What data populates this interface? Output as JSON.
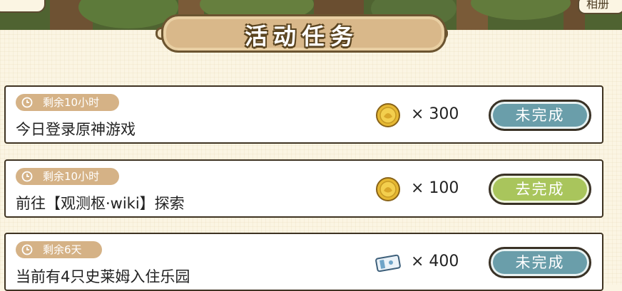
{
  "header": {
    "title": "活动任务",
    "top_right_label": "相册"
  },
  "tasks": [
    {
      "time_left": "剩余10小时",
      "name": "今日登录原神游戏",
      "reward_icon": "coin-icon",
      "reward_count": "× 300",
      "status": "未完成",
      "status_type": "incomplete"
    },
    {
      "time_left": "剩余10小时",
      "name": "前往【观测枢·wiki】探索",
      "reward_icon": "coin-icon",
      "reward_count": "× 100",
      "status": "去完成",
      "status_type": "go"
    },
    {
      "time_left": "剩余6天",
      "name": "当前有4只史莱姆入住乐园",
      "reward_icon": "ticket-icon",
      "reward_count": "× 400",
      "status": "未完成",
      "status_type": "incomplete"
    }
  ],
  "colors": {
    "incomplete_button": "#6a9eaa",
    "go_button": "#a9c55c",
    "time_pill": "#d5b286"
  }
}
